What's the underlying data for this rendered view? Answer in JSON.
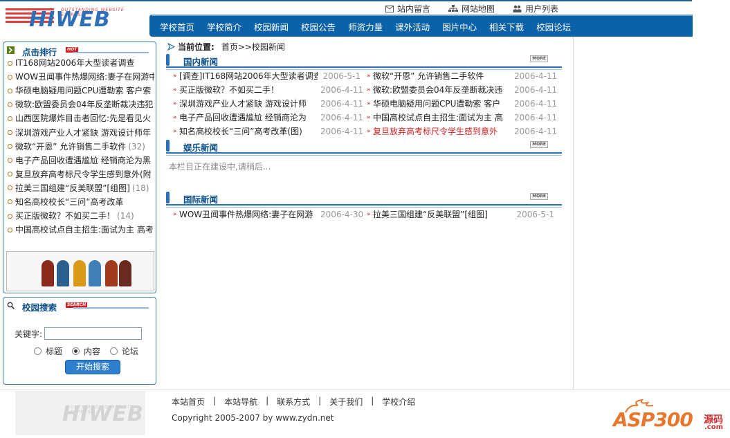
{
  "header": {
    "logo_text": "HIWEB",
    "logo_tagline": "OUTSTANDING WEBSITE EXPRESS",
    "top_links": [
      {
        "label": "站内留言",
        "icon": "mail-icon"
      },
      {
        "label": "网站地图",
        "icon": "sitemap-icon"
      },
      {
        "label": "用户列表",
        "icon": "users-icon"
      }
    ],
    "nav": [
      "学校首页",
      "学校简介",
      "校园新闻",
      "校园公告",
      "师资力量",
      "课外活动",
      "图片中心",
      "相关下载",
      "校园论坛"
    ]
  },
  "sidebar": {
    "rank": {
      "title": "点击排行",
      "badge": "HOT",
      "items": [
        {
          "title": "IT168网站2006年大型读者调查",
          "count": ""
        },
        {
          "title": "WOW丑闻事件热爆网络:妻子在网游中",
          "count": ""
        },
        {
          "title": "华硕电脑疑用问题CPU遭勒索 客户索",
          "count": ""
        },
        {
          "title": "微软:欧盟委员会04年反垄断裁决违犯",
          "count": ""
        },
        {
          "title": "山西医院爆炸目击者回忆:先是看见火",
          "count": ""
        },
        {
          "title": "深圳游戏产业人才紧缺 游戏设计师年",
          "count": ""
        },
        {
          "title": "微软“开恩” 允许销售二手软件",
          "count": "(32)"
        },
        {
          "title": "电子产品回收遭遇尴尬 经销商沦为黑",
          "count": ""
        },
        {
          "title": "复旦放弃高考标尺令学生感到意外(附",
          "count": ""
        },
        {
          "title": "拉美三国组建“反美联盟”[组图]",
          "count": "(18)"
        },
        {
          "title": "知名高校校长“三问”高考改革",
          "count": ""
        },
        {
          "title": "买正版微软？不如买二手！",
          "count": "(14)"
        },
        {
          "title": "中国高校试点自主招生:面试为主 高考",
          "count": ""
        }
      ]
    },
    "search": {
      "title": "校园搜索",
      "badge": "SEARCH",
      "keyword_label": "关键字:",
      "keyword_value": "",
      "options": [
        {
          "label": "标题",
          "checked": false
        },
        {
          "label": "内容",
          "checked": true
        },
        {
          "label": "论坛",
          "checked": false
        }
      ],
      "button": "开始搜索"
    }
  },
  "main": {
    "breadcrumb": {
      "label": "当前位置:",
      "path": "首页>>校园新闻"
    },
    "sections": {
      "domestic": {
        "title": "国内新闻",
        "more": "MORE",
        "left": [
          {
            "title": "[调查]IT168网站2006年大型读者调查",
            "date": "2006-5-1",
            "hot": false
          },
          {
            "title": "买正版微软？不如买二手！",
            "date": "2006-4-11",
            "hot": false
          },
          {
            "title": "深圳游戏产业人才紧缺 游戏设计师",
            "date": "2006-4-11",
            "hot": false
          },
          {
            "title": "电子产品回收遭遇尴尬 经销商沦为",
            "date": "2006-4-11",
            "hot": false
          },
          {
            "title": "知名高校校长“三问”高考改革(图)",
            "date": "2006-4-11",
            "hot": false
          }
        ],
        "right": [
          {
            "title": "微软“开恩” 允许销售二手软件",
            "date": "2006-4-11",
            "hot": false
          },
          {
            "title": "微软:欧盟委员会04年反垄断裁决违",
            "date": "2006-4-11",
            "hot": false
          },
          {
            "title": "华硕电脑疑用问题CPU遭勒索 客户",
            "date": "2006-4-11",
            "hot": false
          },
          {
            "title": "中国高校试点自主招生:面试为主 高",
            "date": "2006-4-11",
            "hot": false
          },
          {
            "title": "复旦放弃高考标尺令学生感到意外",
            "date": "2006-4-11",
            "hot": true
          }
        ]
      },
      "entertainment": {
        "title": "娱乐新闻",
        "more": "MORE",
        "placeholder": "本栏目正在建设中,请稍后..."
      },
      "international": {
        "title": "国际新闻",
        "more": "MORE",
        "left": [
          {
            "title": "WOW丑闻事件热爆网络:妻子在网游",
            "date": "2006-4-30",
            "hot": false
          }
        ],
        "right": [
          {
            "title": "拉美三国组建“反美联盟”[组图]",
            "date": "2006-5-1",
            "hot": false
          }
        ]
      }
    }
  },
  "footer": {
    "links": [
      "本站首页",
      "本站导航",
      "联系方式",
      "关于我们",
      "学校介绍"
    ],
    "copyright": "Copyright 2005-2007 by www.zydn.net",
    "watermark": {
      "brand": "ASP300",
      "cn": "源码",
      "suffix": ".com"
    }
  },
  "colors": {
    "nav_bg": "#0b62a8",
    "accent_blue": "#2671b7",
    "hot_red": "#d81e1e",
    "date_gray": "#999999"
  }
}
